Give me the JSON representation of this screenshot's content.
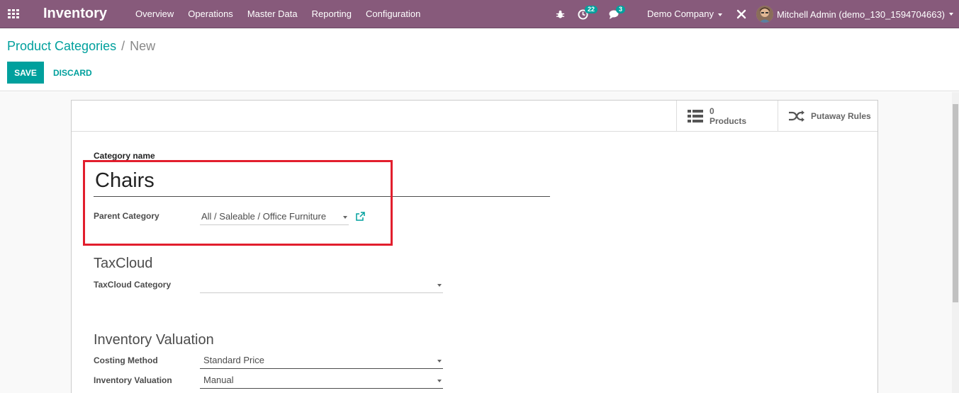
{
  "navbar": {
    "app_name": "Inventory",
    "menu": [
      "Overview",
      "Operations",
      "Master Data",
      "Reporting",
      "Configuration"
    ],
    "activity_count": "22",
    "message_count": "3",
    "company": "Demo Company",
    "user": "Mitchell Admin (demo_130_1594704663)",
    "bar_color": "#875a7b"
  },
  "breadcrumb": {
    "parent": "Product Categories",
    "current": "New"
  },
  "actions": {
    "save": "SAVE",
    "discard": "DISCARD"
  },
  "smart_buttons": {
    "products_count": "0",
    "products_label": "Products",
    "putaway_label": "Putaway Rules"
  },
  "form": {
    "category_name_label": "Category name",
    "category_name": "Chairs",
    "parent_category_label": "Parent Category",
    "parent_category": "All / Saleable / Office Furniture",
    "taxcloud_section": "TaxCloud",
    "taxcloud_category_label": "TaxCloud Category",
    "taxcloud_category": "",
    "valuation_section": "Inventory Valuation",
    "costing_method_label": "Costing Method",
    "costing_method": "Standard Price",
    "inventory_valuation_label": "Inventory Valuation",
    "inventory_valuation": "Manual"
  },
  "colors": {
    "accent": "#00a09d",
    "highlight": "#e21e2d"
  }
}
